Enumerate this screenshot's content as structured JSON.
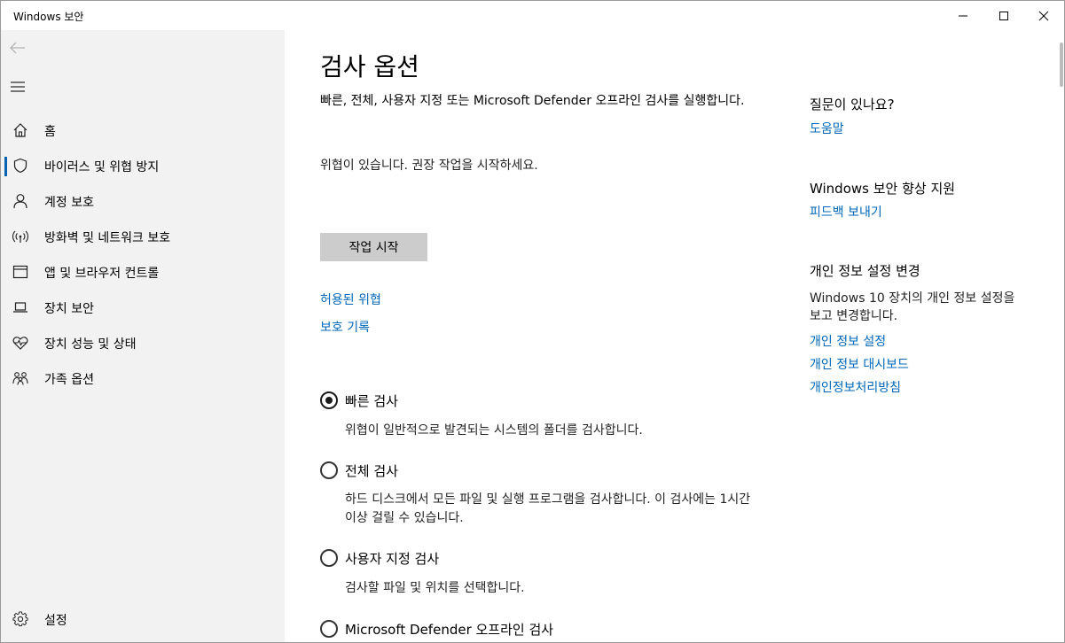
{
  "window": {
    "title": "Windows 보안"
  },
  "sidebar": {
    "items": [
      {
        "label": "홈",
        "icon": "home-icon"
      },
      {
        "label": "바이러스 및 위협 방지",
        "icon": "shield-icon",
        "active": true
      },
      {
        "label": "계정 보호",
        "icon": "person-icon"
      },
      {
        "label": "방화벽 및 네트워크 보호",
        "icon": "wireless-icon"
      },
      {
        "label": "앱 및 브라우저 컨트롤",
        "icon": "app-window-icon"
      },
      {
        "label": "장치 보안",
        "icon": "laptop-icon"
      },
      {
        "label": "장치 성능 및 상태",
        "icon": "heart-pulse-icon"
      },
      {
        "label": "가족 옵션",
        "icon": "family-icon"
      }
    ],
    "settings_label": "설정"
  },
  "main": {
    "title": "검사 옵션",
    "description": "빠른, 전체, 사용자 지정 또는 Microsoft Defender 오프라인 검사를 실행합니다.",
    "threat_status": "위협이 있습니다. 권장 작업을 시작하세요.",
    "start_button": "작업 시작",
    "links": {
      "allowed_threats": "허용된 위협",
      "protection_history": "보호 기록"
    },
    "scan_options": [
      {
        "label": "빠른 검사",
        "desc": "위협이 일반적으로 발견되는 시스템의 폴더를 검사합니다.",
        "checked": true
      },
      {
        "label": "전체 검사",
        "desc": "하드 디스크에서 모든 파일 및 실행 프로그램을 검사합니다. 이 검사에는 1시간 이상 걸릴 수 있습니다.",
        "checked": false
      },
      {
        "label": "사용자 지정 검사",
        "desc": "검사할 파일 및 위치를 선택합니다.",
        "checked": false
      },
      {
        "label": "Microsoft Defender 오프라인 검사",
        "desc": "",
        "checked": false
      }
    ]
  },
  "right_panel": {
    "question_heading": "질문이 있나요?",
    "help_link": "도움말",
    "improve_heading": "Windows 보안 향상 지원",
    "feedback_link": "피드백 보내기",
    "privacy_heading": "개인 정보 설정 변경",
    "privacy_text": "Windows 10 장치의 개인 정보 설정을 보고 변경합니다.",
    "privacy_settings_link": "개인 정보 설정",
    "privacy_dashboard_link": "개인 정보 대시보드",
    "privacy_statement_link": "개인정보처리방침"
  },
  "colors": {
    "accent": "#0063b1",
    "link": "#0067b8",
    "sidebar_bg": "#f2f2f2",
    "button_bg": "#cccccc"
  }
}
